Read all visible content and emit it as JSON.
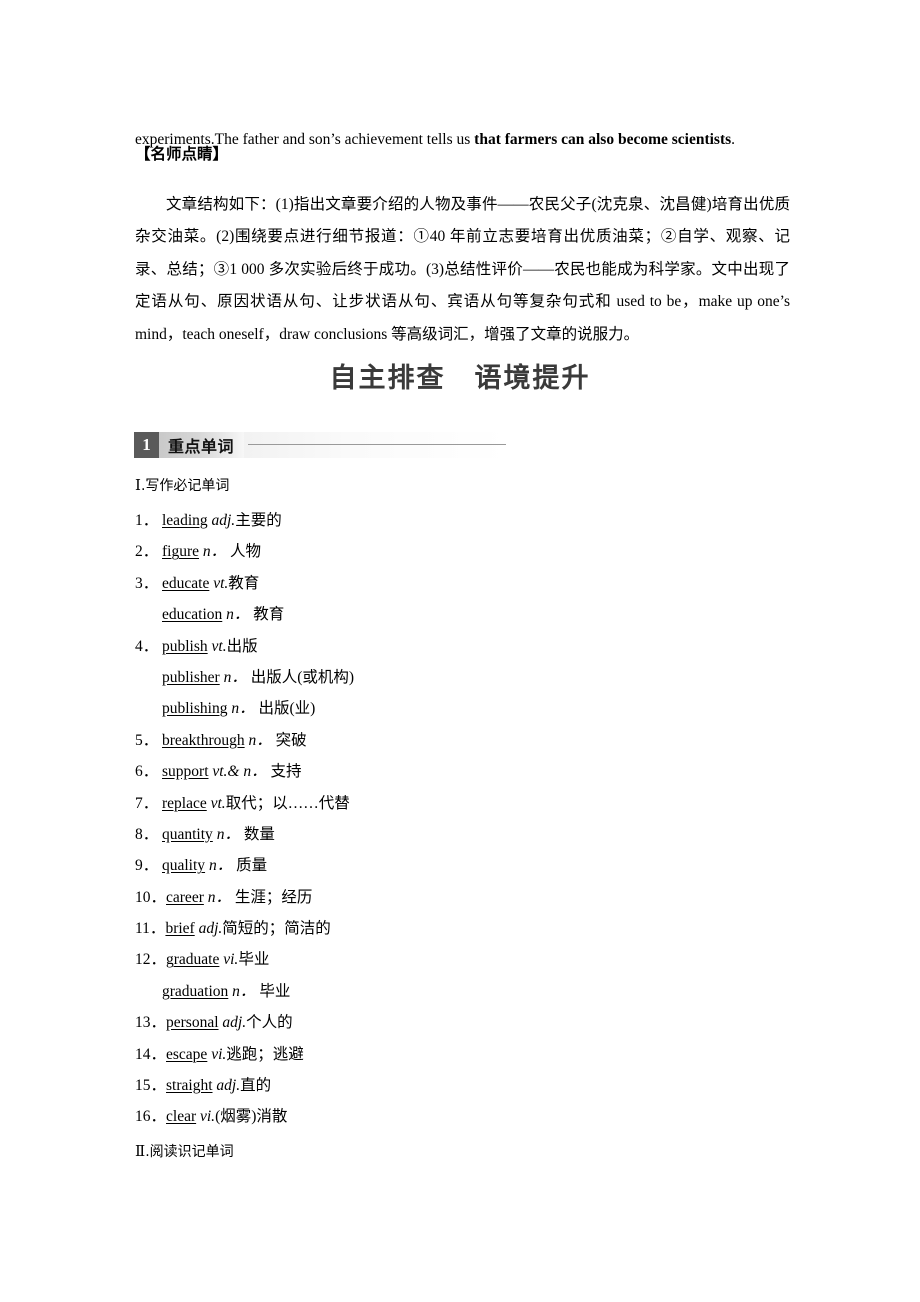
{
  "document": {
    "continuation_paragraph": {
      "plain_before": "experiments.The father and son’s achievement tells us ",
      "bold_part": "that farmers can also become scientists",
      "plain_after": "."
    },
    "tip_heading": "【名师点睛】",
    "tip_body": "文章结构如下：(1)指出文章要介绍的人物及事件——农民父子(沈克泉、沈昌健)培育出优质杂交油菜。(2)围绕要点进行细节报道：①40 年前立志要培育出优质油菜；②自学、观察、记录、总结；③1 000 多次实验后终于成功。(3)总结性评价——农民也能成为科学家。文中出现了定语从句、原因状语从句、让步状语从句、宾语从句等复杂句式和 used to be，make up one’s mind，teach oneself，draw conclusions 等高级词汇，增强了文章的说服力。",
    "main_title": "自主排查　语境提升"
  },
  "section": {
    "number": "1",
    "label": "重点单词"
  },
  "subheadings": {
    "one": {
      "numeral": "Ⅰ",
      "text": ".写作必记单词"
    },
    "two": {
      "numeral": "Ⅱ",
      "text": ".阅读识记单词"
    }
  },
  "words": [
    {
      "num": "1．",
      "term": "leading",
      "pos": "adj.",
      "gap": "",
      "def": "主要的"
    },
    {
      "num": "2．",
      "term": "figure",
      "pos": "n．",
      "gap": " ",
      "def": "人物"
    },
    {
      "num": "3．",
      "term": "educate",
      "pos": "vt.",
      "gap": "",
      "def": "教育"
    },
    {
      "num": "",
      "term": "education",
      "pos": "n．",
      "gap": " ",
      "def": "教育"
    },
    {
      "num": "4．",
      "term": "publish",
      "pos": "vt.",
      "gap": "",
      "def": "出版"
    },
    {
      "num": "",
      "term": "publisher",
      "pos": "n．",
      "gap": " ",
      "def": "出版人(或机构)"
    },
    {
      "num": "",
      "term": "publishing",
      "pos": "n．",
      "gap": " ",
      "def": "出版(业)"
    },
    {
      "num": "5．",
      "term": "breakthrough",
      "pos": "n．",
      "gap": " ",
      "def": "突破"
    },
    {
      "num": "6．",
      "term": "support",
      "pos": "vt.& n．",
      "gap": " ",
      "def": "支持"
    },
    {
      "num": "7．",
      "term": "replace",
      "pos": "vt.",
      "gap": "",
      "def": "取代；以……代替"
    },
    {
      "num": "8．",
      "term": "quantity",
      "pos": "n．",
      "gap": " ",
      "def": "数量"
    },
    {
      "num": "9．",
      "term": "quality",
      "pos": "n．",
      "gap": " ",
      "def": "质量"
    },
    {
      "num": "10．",
      "term": "career",
      "pos": "n．",
      "gap": " ",
      "def": "生涯；经历"
    },
    {
      "num": "11．",
      "term": "brief",
      "pos": "adj.",
      "gap": "",
      "def": "简短的；简洁的"
    },
    {
      "num": "12．",
      "term": "graduate",
      "pos": "vi.",
      "gap": "",
      "def": "毕业"
    },
    {
      "num": "",
      "term": "graduation",
      "pos": "n．",
      "gap": " ",
      "def": "毕业"
    },
    {
      "num": "13．",
      "term": "personal",
      "pos": "adj.",
      "gap": "",
      "def": "个人的"
    },
    {
      "num": "14．",
      "term": "escape",
      "pos": "vi.",
      "gap": "",
      "def": "逃跑；逃避"
    },
    {
      "num": "15．",
      "term": "straight",
      "pos": "adj.",
      "gap": "",
      "def": "直的"
    },
    {
      "num": "16．",
      "term": "clear",
      "pos": "vi.",
      "gap": "",
      "def": "(烟雾)消散"
    }
  ],
  "colors": {
    "badge_bg": "#5a5a5a",
    "badge_text": "#ffffff",
    "title_text": "#3a3a3a",
    "rule_line": "#9a9a9a"
  }
}
